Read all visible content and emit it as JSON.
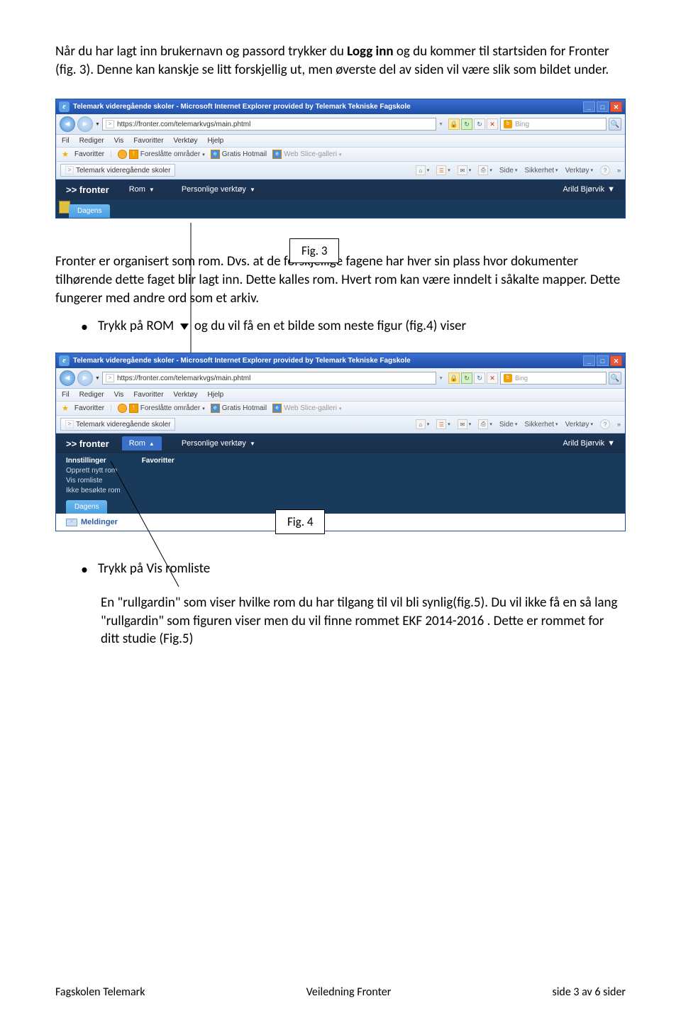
{
  "intro": {
    "p1_before": "Når du har lagt inn brukernavn og passord trykker du ",
    "logg_inn": "Logg inn",
    "p1_after": " og du kommer til startsiden for Fronter (fig. 3). Denne kan kanskje se litt forskjellig ut, men øverste del av siden vil være slik som bildet under."
  },
  "browser": {
    "title": "Telemark videregående skoler - Microsoft Internet Explorer provided by Telemark Tekniske Fagskole",
    "url": "https://fronter.com/telemarkvgs/main.phtml",
    "search_provider": "Bing",
    "menu": [
      "Fil",
      "Rediger",
      "Vis",
      "Favoritter",
      "Verktøy",
      "Hjelp"
    ],
    "fav_label": "Favoritter",
    "fav_suggest": "Foreslåtte områder",
    "fav_hotmail": "Gratis Hotmail",
    "fav_slice": "Web Slice-galleri",
    "tab_name": "Telemark videregående skoler",
    "tools": {
      "side": "Side",
      "sikkerhet": "Sikkerhet",
      "verktoy": "Verktøy"
    }
  },
  "fronter": {
    "brand": ">> fronter",
    "rom": "Rom",
    "verktoy": "Personlige verktøy",
    "user": "Arild Bjørvik",
    "dagens": "Dagens",
    "meldinger": "Meldinger",
    "menu": {
      "innstillinger": "Innstillinger",
      "opprett": "Opprett nytt rom",
      "vis": "Vis romliste",
      "ikke": "Ikke besøkte rom",
      "favoritter": "Favoritter"
    }
  },
  "fig3_label": "Fig. 3",
  "fig4_label": "Fig. 4",
  "mid": {
    "p2": "Fronter er organisert som rom. Dvs. at de forskjellige fagene har hver sin plass hvor dokumenter tilhørende dette faget blir lagt inn. Dette kalles rom. Hvert rom kan være inndelt i såkalte mapper. Dette fungerer med andre ord som et arkiv.",
    "bullet1_a": "Trykk på ROM ",
    "bullet1_b": " og du vil få en et bilde som neste figur (fig.4) viser"
  },
  "end": {
    "bullet2": "Trykk på Vis romliste",
    "p3": "En \"rullgardin\" som viser hvilke rom du har tilgang til vil bli synlig(fig.5). Du vil ikke få en så lang \"rullgardin\" som figuren viser men du vil finne rommet EKF 2014-2016 . Dette er rommet for ditt studie (Fig.5)"
  },
  "footer": {
    "left": "Fagskolen Telemark",
    "mid": "Veiledning Fronter",
    "right": "side 3  av  6  sider"
  }
}
